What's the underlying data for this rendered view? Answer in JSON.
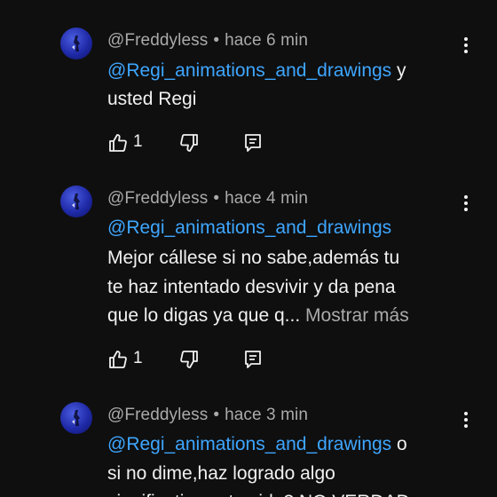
{
  "comments": [
    {
      "author": "@Freddyless",
      "separator": "•",
      "time": "hace 6 min",
      "mention": "@Regi_animations_and_drawings",
      "line1_tail": " y",
      "lines": [
        "usted Regi"
      ],
      "likes": "1"
    },
    {
      "author": "@Freddyless",
      "separator": "•",
      "time": "hace 4 min",
      "mention": "@Regi_animations_and_drawings",
      "line1_tail": "",
      "lines": [
        "Mejor cállese si no sabe,además tu",
        "te haz intentado desvivir y da pena",
        "que lo digas ya que q..."
      ],
      "more_label": "Mostrar más",
      "likes": "1"
    },
    {
      "author": "@Freddyless",
      "separator": "•",
      "time": "hace 3 min",
      "mention": "@Regi_animations_and_drawings",
      "line1_tail": " o",
      "lines": [
        "si no dime,haz logrado algo",
        "significativo esta vida? NO VERDAD"
      ]
    }
  ],
  "icons": {
    "like": "thumbs-up-icon",
    "dislike": "thumbs-down-icon",
    "reply": "reply-icon",
    "menu": "more-vert-icon"
  },
  "colors": {
    "background": "#0f0f0f",
    "text": "#f1f1f1",
    "secondary": "#aaaaaa",
    "mention": "#3ea6ff"
  }
}
